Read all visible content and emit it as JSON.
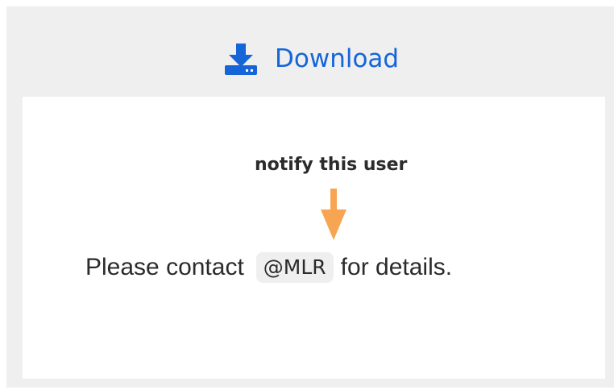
{
  "download": {
    "label": "Download",
    "icon": "download-icon",
    "color": "#1565d8"
  },
  "preview": {
    "annotation": "notify this user",
    "arrow_color": "#f7a552",
    "sentence_before": "Please contact",
    "mention": "@MLR",
    "sentence_after": "for details."
  },
  "colors": {
    "frame_background": "#efefef",
    "preview_background": "#ffffff",
    "text": "#2b2b2b"
  }
}
